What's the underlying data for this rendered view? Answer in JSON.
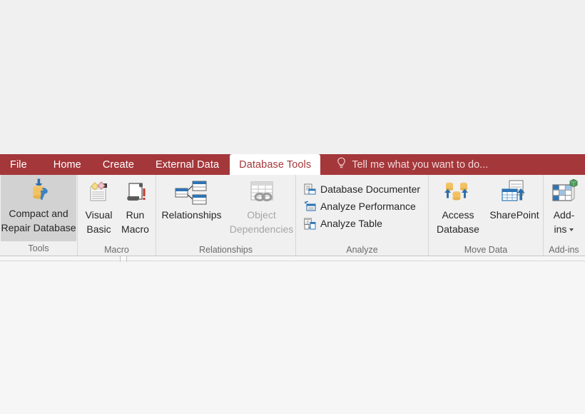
{
  "app": {
    "accent_color": "#a4373a",
    "ribbon_background": "#f0f0f0",
    "canvas_background": "#f6f6f6"
  },
  "tabs": [
    {
      "label": "File",
      "active": false
    },
    {
      "label": "Home",
      "active": false
    },
    {
      "label": "Create",
      "active": false
    },
    {
      "label": "External Data",
      "active": false
    },
    {
      "label": "Database Tools",
      "active": true
    }
  ],
  "tell_me": {
    "icon": "lightbulb-icon",
    "placeholder": "Tell me what you want to do..."
  },
  "groups": [
    {
      "name": "tools",
      "label": "Tools",
      "items": [
        {
          "name": "compact-and-repair-database",
          "label": "Compact and\nRepair Database",
          "icon": "database-repair-icon",
          "state": "highlighted",
          "disabled": false
        }
      ]
    },
    {
      "name": "macro",
      "label": "Macro",
      "items": [
        {
          "name": "visual-basic",
          "label": "Visual\nBasic",
          "icon": "visual-basic-icon",
          "state": "normal",
          "disabled": false
        },
        {
          "name": "run-macro",
          "label": "Run\nMacro",
          "icon": "run-macro-icon",
          "state": "normal",
          "disabled": false
        }
      ]
    },
    {
      "name": "relationships",
      "label": "Relationships",
      "items": [
        {
          "name": "relationships",
          "label": "Relationships",
          "icon": "relationships-icon",
          "state": "normal",
          "disabled": false
        },
        {
          "name": "object-dependencies",
          "label": "Object\nDependencies",
          "icon": "object-dependencies-icon",
          "state": "disabled",
          "disabled": true
        }
      ]
    },
    {
      "name": "analyze",
      "label": "Analyze",
      "items": [
        {
          "name": "database-documenter",
          "label": "Database Documenter",
          "icon": "database-documenter-icon",
          "state": "normal",
          "disabled": false
        },
        {
          "name": "analyze-performance",
          "label": "Analyze Performance",
          "icon": "analyze-performance-icon",
          "state": "normal",
          "disabled": false
        },
        {
          "name": "analyze-table",
          "label": "Analyze Table",
          "icon": "analyze-table-icon",
          "state": "normal",
          "disabled": false
        }
      ]
    },
    {
      "name": "move-data",
      "label": "Move Data",
      "items": [
        {
          "name": "access-database",
          "label": "Access\nDatabase",
          "icon": "access-database-icon",
          "state": "normal",
          "disabled": false
        },
        {
          "name": "sharepoint",
          "label": "SharePoint",
          "icon": "sharepoint-icon",
          "state": "normal",
          "disabled": false
        }
      ]
    },
    {
      "name": "add-ins",
      "label": "Add-ins",
      "items": [
        {
          "name": "add-ins",
          "label": "Add-\nins",
          "icon": "add-ins-icon",
          "state": "normal",
          "disabled": false,
          "has_dropdown": true
        }
      ]
    }
  ]
}
